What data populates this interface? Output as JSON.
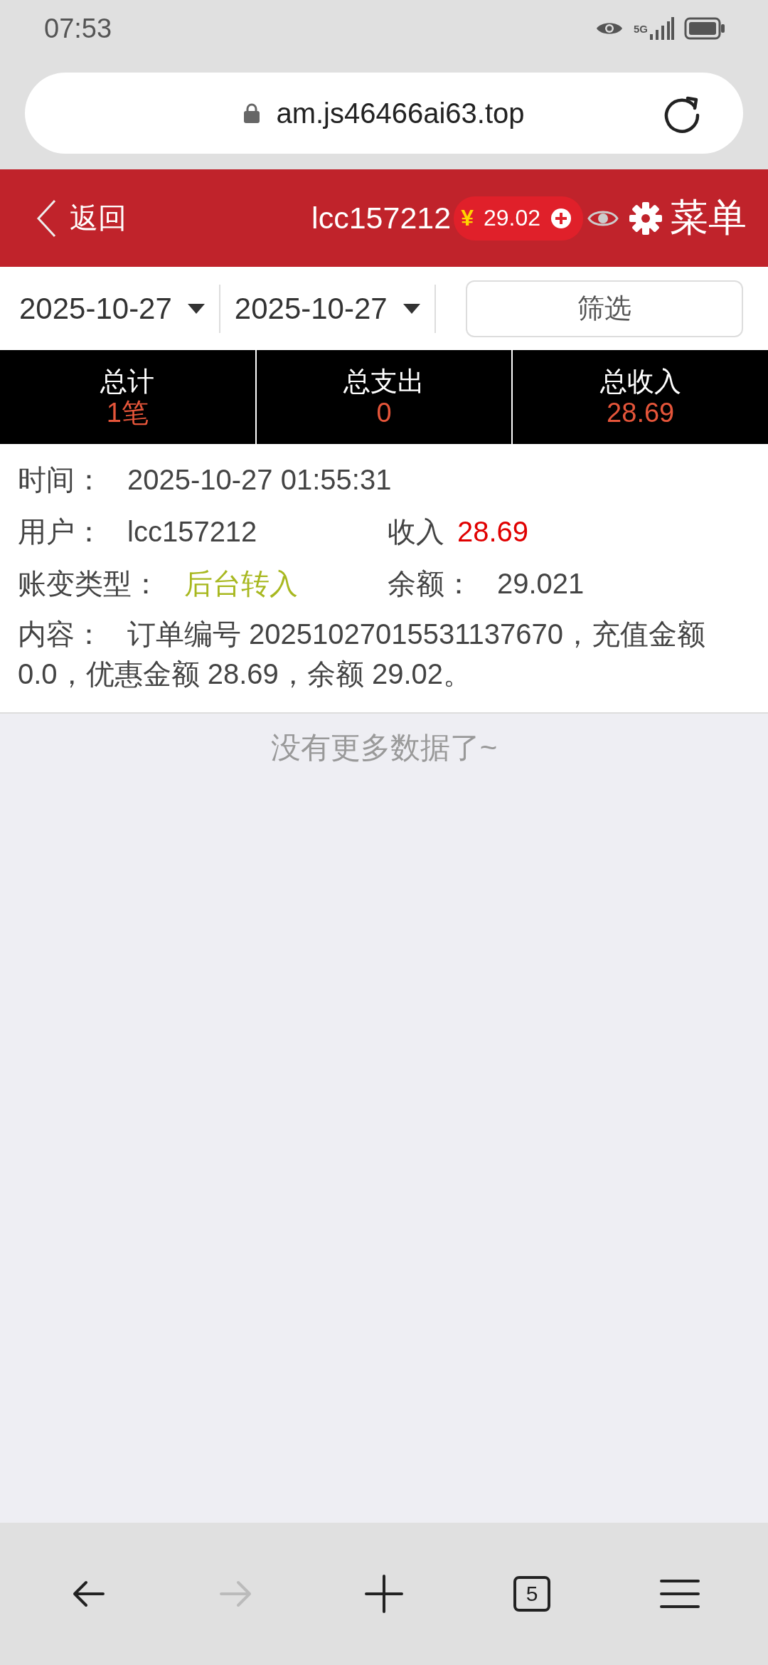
{
  "status_bar": {
    "time": "07:53",
    "network": "5G"
  },
  "browser": {
    "url": "am.js46466ai63.top"
  },
  "header": {
    "back_label": "返回",
    "username": "lcc157212",
    "balance": {
      "currency": "¥",
      "amount": "29.02"
    },
    "menu_label": "菜单"
  },
  "filter": {
    "start_date": "2025-10-27",
    "end_date": "2025-10-27",
    "button": "筛选"
  },
  "summary": [
    {
      "label": "总计",
      "value": "1笔"
    },
    {
      "label": "总支出",
      "value": "0"
    },
    {
      "label": "总收入",
      "value": "28.69"
    }
  ],
  "record": {
    "rows": [
      [
        {
          "label": "时间：",
          "value": "2025-10-27 01:55:31",
          "kind": "plain"
        }
      ],
      [
        {
          "label": "用户：",
          "value": "lcc157212",
          "kind": "plain"
        },
        {
          "label": "收入",
          "value": "28.69",
          "kind": "income"
        }
      ],
      [
        {
          "label": "账变类型：",
          "value": "后台转入",
          "kind": "transfer"
        },
        {
          "label": "余额：",
          "value": "29.021",
          "kind": "plain"
        }
      ]
    ],
    "content": {
      "label": "内容：",
      "value": "订单编号 20251027015531137670，充值金额 0.0，优惠金额 28.69，余额 29.02。"
    }
  },
  "end_message": "没有更多数据了~",
  "toolbar": [
    {
      "kind": "back",
      "disabled": false
    },
    {
      "kind": "forward",
      "disabled": true
    },
    {
      "kind": "new-tab",
      "disabled": false
    },
    {
      "kind": "tabs",
      "label": "5",
      "disabled": false
    },
    {
      "kind": "menu",
      "disabled": false
    }
  ]
}
